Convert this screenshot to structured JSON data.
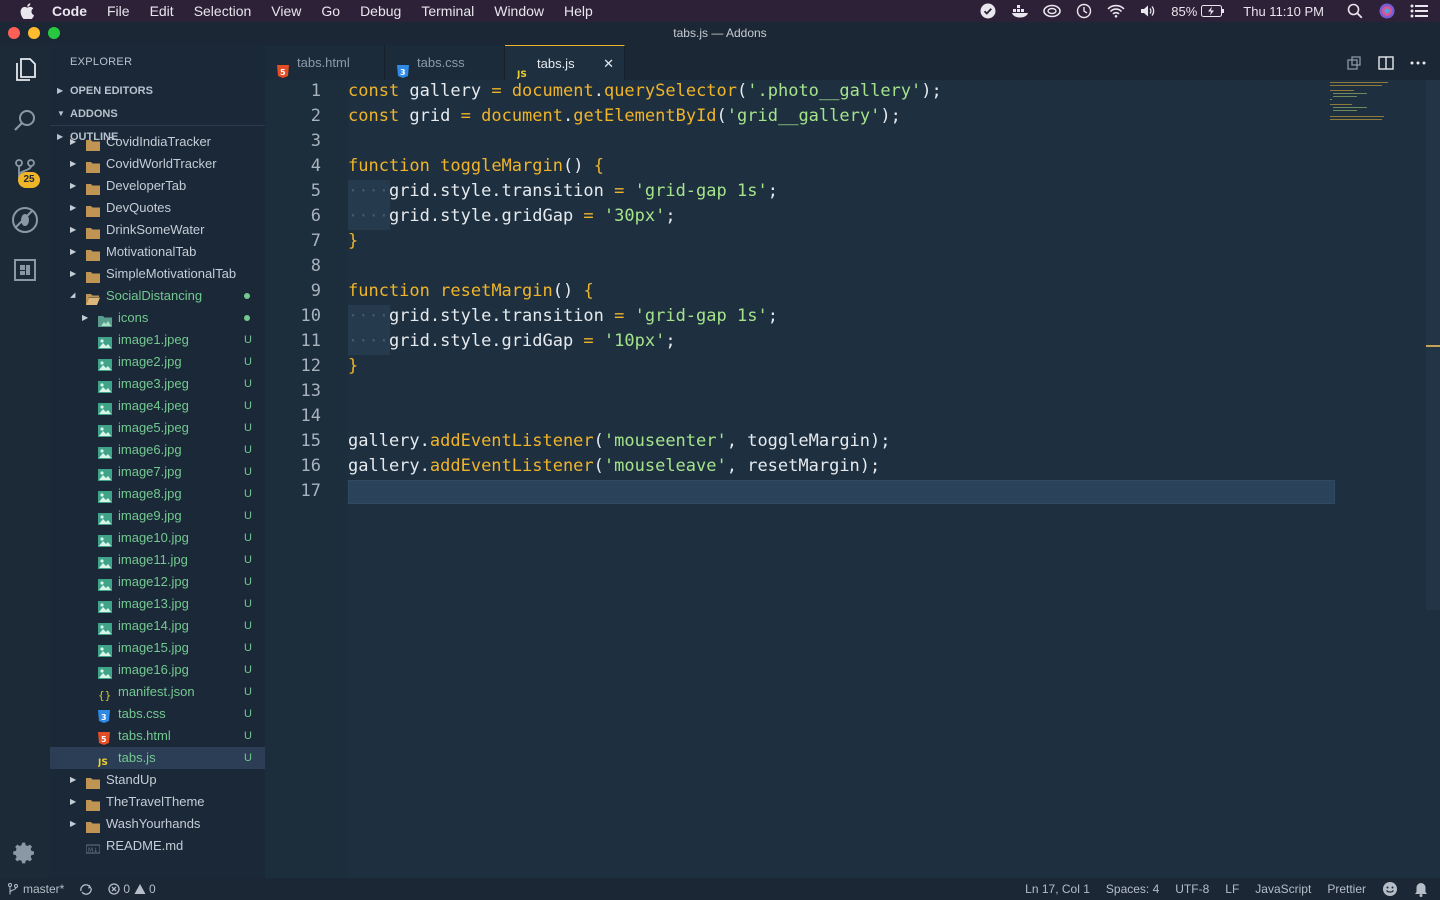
{
  "menubar": {
    "app": "Code",
    "items": [
      "File",
      "Edit",
      "Selection",
      "View",
      "Go",
      "Debug",
      "Terminal",
      "Window",
      "Help"
    ],
    "battery": "85%",
    "clock": "Thu 11:10 PM"
  },
  "window": {
    "title": "tabs.js — Addons"
  },
  "activitybar": {
    "scm_badge": "25"
  },
  "sidebar": {
    "title": "EXPLORER",
    "open_editors": "OPEN EDITORS",
    "workspace": "ADDONS",
    "outline": "OUTLINE",
    "tree": [
      {
        "label": "CovidIndiaTracker",
        "type": "folder",
        "depth": 0,
        "status": ""
      },
      {
        "label": "CovidWorldTracker",
        "type": "folder",
        "depth": 0,
        "status": ""
      },
      {
        "label": "DeveloperTab",
        "type": "folder",
        "depth": 0,
        "status": ""
      },
      {
        "label": "DevQuotes",
        "type": "folder",
        "depth": 0,
        "status": ""
      },
      {
        "label": "DrinkSomeWater",
        "type": "folder",
        "depth": 0,
        "status": ""
      },
      {
        "label": "MotivationalTab",
        "type": "folder",
        "depth": 0,
        "status": ""
      },
      {
        "label": "SimpleMotivationalTab",
        "type": "folder",
        "depth": 0,
        "status": ""
      },
      {
        "label": "SocialDistancing",
        "type": "folder-open",
        "depth": 0,
        "status": "dot"
      },
      {
        "label": "icons",
        "type": "folder-img",
        "depth": 1,
        "status": "dot"
      },
      {
        "label": "image1.jpeg",
        "type": "image",
        "depth": 1,
        "status": "U"
      },
      {
        "label": "image2.jpg",
        "type": "image",
        "depth": 1,
        "status": "U"
      },
      {
        "label": "image3.jpeg",
        "type": "image",
        "depth": 1,
        "status": "U"
      },
      {
        "label": "image4.jpeg",
        "type": "image",
        "depth": 1,
        "status": "U"
      },
      {
        "label": "image5.jpeg",
        "type": "image",
        "depth": 1,
        "status": "U"
      },
      {
        "label": "image6.jpg",
        "type": "image",
        "depth": 1,
        "status": "U"
      },
      {
        "label": "image7.jpg",
        "type": "image",
        "depth": 1,
        "status": "U"
      },
      {
        "label": "image8.jpg",
        "type": "image",
        "depth": 1,
        "status": "U"
      },
      {
        "label": "image9.jpg",
        "type": "image",
        "depth": 1,
        "status": "U"
      },
      {
        "label": "image10.jpg",
        "type": "image",
        "depth": 1,
        "status": "U"
      },
      {
        "label": "image11.jpg",
        "type": "image",
        "depth": 1,
        "status": "U"
      },
      {
        "label": "image12.jpg",
        "type": "image",
        "depth": 1,
        "status": "U"
      },
      {
        "label": "image13.jpg",
        "type": "image",
        "depth": 1,
        "status": "U"
      },
      {
        "label": "image14.jpg",
        "type": "image",
        "depth": 1,
        "status": "U"
      },
      {
        "label": "image15.jpg",
        "type": "image",
        "depth": 1,
        "status": "U"
      },
      {
        "label": "image16.jpg",
        "type": "image",
        "depth": 1,
        "status": "U"
      },
      {
        "label": "manifest.json",
        "type": "json",
        "depth": 1,
        "status": "U"
      },
      {
        "label": "tabs.css",
        "type": "css",
        "depth": 1,
        "status": "U"
      },
      {
        "label": "tabs.html",
        "type": "html",
        "depth": 1,
        "status": "U"
      },
      {
        "label": "tabs.js",
        "type": "js",
        "depth": 1,
        "status": "U",
        "selected": true
      },
      {
        "label": "StandUp",
        "type": "folder",
        "depth": 0,
        "status": ""
      },
      {
        "label": "TheTravelTheme",
        "type": "folder",
        "depth": 0,
        "status": ""
      },
      {
        "label": "WashYourhands",
        "type": "folder",
        "depth": 0,
        "status": ""
      },
      {
        "label": "README.md",
        "type": "md",
        "depth": 0,
        "status": ""
      }
    ]
  },
  "tabs": [
    {
      "label": "tabs.html",
      "type": "html"
    },
    {
      "label": "tabs.css",
      "type": "css"
    },
    {
      "label": "tabs.js",
      "type": "js",
      "active": true
    }
  ],
  "editor": {
    "lines": [
      [
        [
          "kw",
          "const"
        ],
        [
          "p",
          " gallery "
        ],
        [
          "op",
          "="
        ],
        [
          "p",
          " "
        ],
        [
          "fn",
          "document"
        ],
        [
          "p",
          "."
        ],
        [
          "fn",
          "querySelector"
        ],
        [
          "p",
          "("
        ],
        [
          "str",
          "'.photo__gallery'"
        ],
        [
          "p",
          ");"
        ]
      ],
      [
        [
          "kw",
          "const"
        ],
        [
          "p",
          " grid "
        ],
        [
          "op",
          "="
        ],
        [
          "p",
          " "
        ],
        [
          "fn",
          "document"
        ],
        [
          "p",
          "."
        ],
        [
          "fn",
          "getElementById"
        ],
        [
          "p",
          "("
        ],
        [
          "str",
          "'grid__gallery'"
        ],
        [
          "p",
          ");"
        ]
      ],
      [],
      [
        [
          "kw",
          "function"
        ],
        [
          "p",
          " "
        ],
        [
          "fn",
          "toggleMargin"
        ],
        [
          "p",
          "() "
        ],
        [
          "kw",
          "{"
        ]
      ],
      [
        [
          "ws",
          "····"
        ],
        [
          "p",
          "grid.style.transition "
        ],
        [
          "op",
          "="
        ],
        [
          "p",
          " "
        ],
        [
          "str",
          "'grid-gap 1s'"
        ],
        [
          "p",
          ";"
        ]
      ],
      [
        [
          "ws",
          "····"
        ],
        [
          "p",
          "grid.style.gridGap "
        ],
        [
          "op",
          "="
        ],
        [
          "p",
          " "
        ],
        [
          "str",
          "'30px'"
        ],
        [
          "p",
          ";"
        ]
      ],
      [
        [
          "kw",
          "}"
        ]
      ],
      [],
      [
        [
          "kw",
          "function"
        ],
        [
          "p",
          " "
        ],
        [
          "fn",
          "resetMargin"
        ],
        [
          "p",
          "() "
        ],
        [
          "kw",
          "{"
        ]
      ],
      [
        [
          "ws",
          "····"
        ],
        [
          "p",
          "grid.style.transition "
        ],
        [
          "op",
          "="
        ],
        [
          "p",
          " "
        ],
        [
          "str",
          "'grid-gap 1s'"
        ],
        [
          "p",
          ";"
        ]
      ],
      [
        [
          "ws",
          "····"
        ],
        [
          "p",
          "grid.style.gridGap "
        ],
        [
          "op",
          "="
        ],
        [
          "p",
          " "
        ],
        [
          "str",
          "'10px'"
        ],
        [
          "p",
          ";"
        ]
      ],
      [
        [
          "kw",
          "}"
        ]
      ],
      [],
      [],
      [
        [
          "p",
          "gallery."
        ],
        [
          "fn",
          "addEventListener"
        ],
        [
          "p",
          "("
        ],
        [
          "str",
          "'mouseenter'"
        ],
        [
          "p",
          ", toggleMargin);"
        ]
      ],
      [
        [
          "p",
          "gallery."
        ],
        [
          "fn",
          "addEventListener"
        ],
        [
          "p",
          "("
        ],
        [
          "str",
          "'mouseleave'"
        ],
        [
          "p",
          ", resetMargin);"
        ]
      ],
      []
    ]
  },
  "statusbar": {
    "branch": "master*",
    "errors": "0",
    "warnings": "0",
    "position": "Ln 17, Col 1",
    "spaces": "Spaces: 4",
    "encoding": "UTF-8",
    "eol": "LF",
    "language": "JavaScript",
    "formatter": "Prettier"
  }
}
